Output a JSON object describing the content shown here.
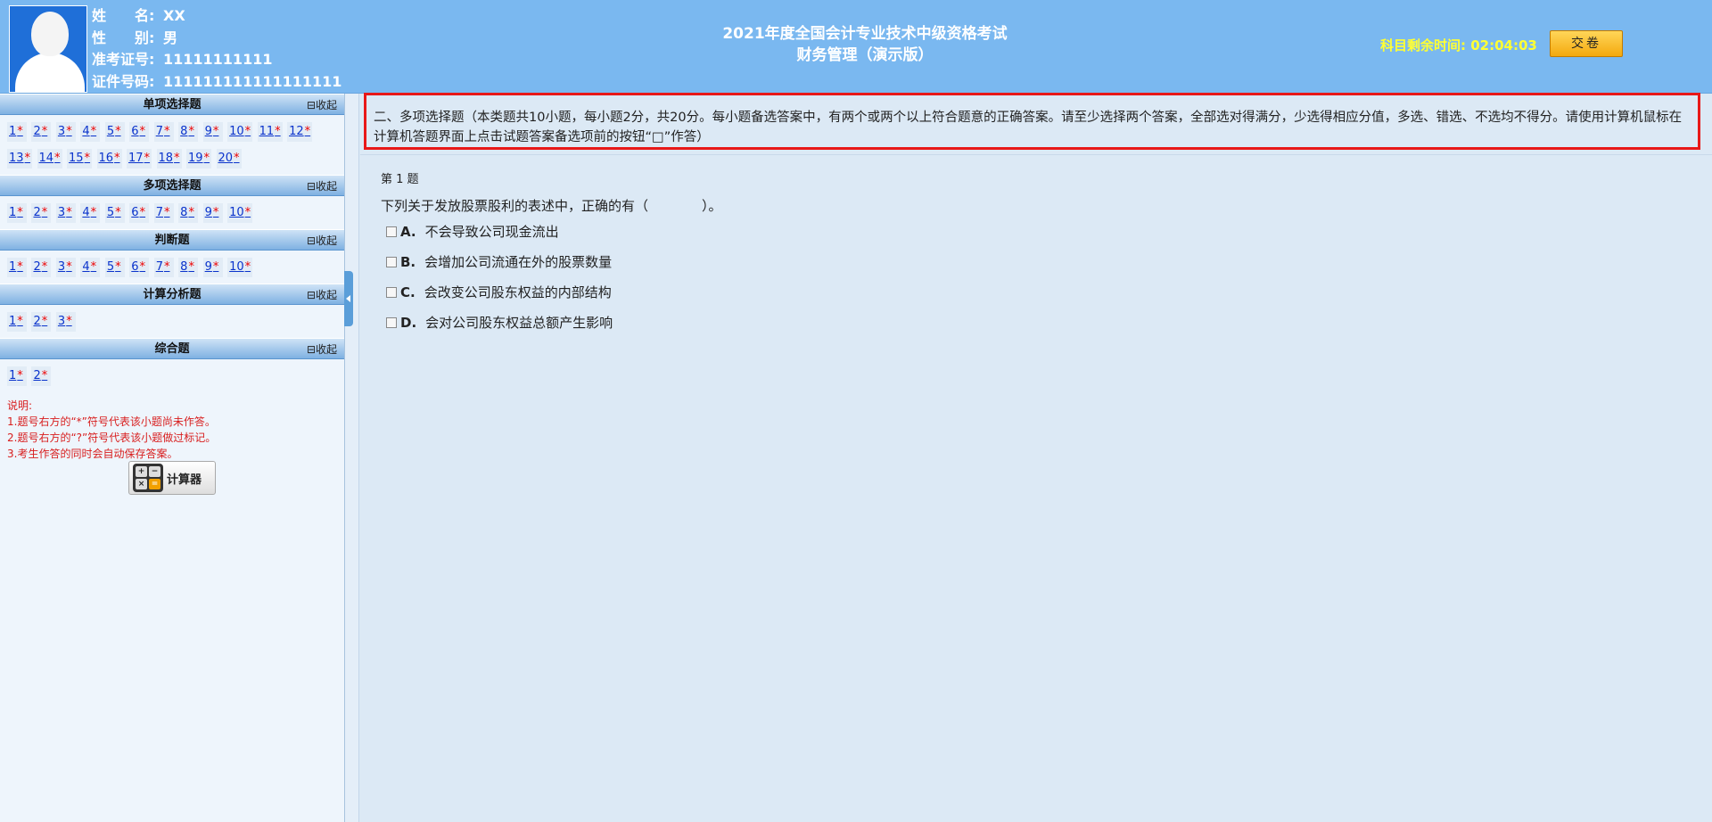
{
  "candidate": {
    "name_label": "姓　　名:",
    "name": "XX",
    "gender_label": "性　　别:",
    "gender": "男",
    "ticket_label": "准考证号:",
    "ticket": "11111111111",
    "id_label": "证件号码:",
    "id": "111111111111111111"
  },
  "exam": {
    "title_line1": "2021年度全国会计专业技术中级资格考试",
    "title_line2": "财务管理（演示版）",
    "timer_label": "科目剩余时间:",
    "timer_value": "02:04:03",
    "submit_label": "交卷"
  },
  "sidebar": {
    "collapse_label": "⊟收起",
    "sections": [
      {
        "title": "单项选择题",
        "count": 20
      },
      {
        "title": "多项选择题",
        "count": 10
      },
      {
        "title": "判断题",
        "count": 10
      },
      {
        "title": "计算分析题",
        "count": 3
      },
      {
        "title": "综合题",
        "count": 2
      }
    ],
    "unanswered_mark": "*",
    "notes": [
      "说明:",
      "1.题号右方的“*”符号代表该小题尚未作答。",
      "2.题号右方的“?”符号代表该小题做过标记。",
      "3.考生作答的同时会自动保存答案。"
    ],
    "calculator_label": "计算器"
  },
  "main": {
    "instructions": "二、多项选择题（本类题共10小题，每小题2分，共20分。每小题备选答案中，有两个或两个以上符合题意的正确答案。请至少选择两个答案，全部选对得满分，少选得相应分值，多选、错选、不选均不得分。请使用计算机鼠标在计算机答题界面上点击试题答案备选项前的按钮“□”作答）",
    "question_number": "第 1 题",
    "question_text": "下列关于发放股票股利的表述中，正确的有（　　　　）。",
    "options": [
      {
        "letter": "A.",
        "text": "不会导致公司现金流出"
      },
      {
        "letter": "B.",
        "text": "会增加公司流通在外的股票数量"
      },
      {
        "letter": "C.",
        "text": "会改变公司股东权益的内部结构"
      },
      {
        "letter": "D.",
        "text": "会对公司股东权益总额产生影响"
      }
    ]
  }
}
